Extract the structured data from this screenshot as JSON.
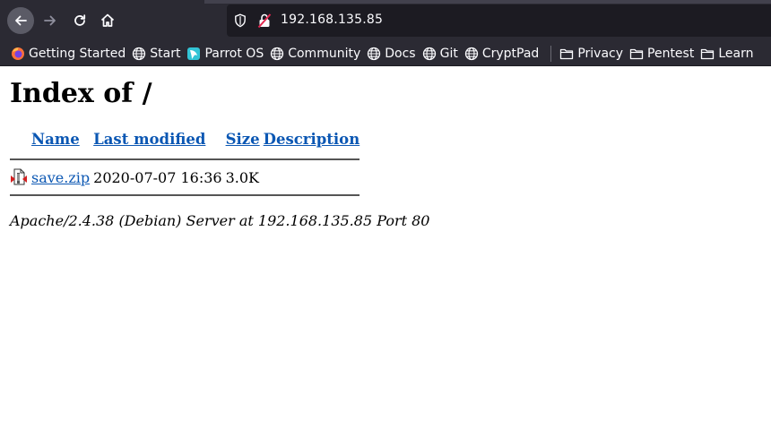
{
  "browser": {
    "url": "192.168.135.85",
    "bookmarks": [
      {
        "label": "Getting Started",
        "icon": "firefox-icon"
      },
      {
        "label": "Start",
        "icon": "globe-icon"
      },
      {
        "label": "Parrot OS",
        "icon": "parrot-icon"
      },
      {
        "label": "Community",
        "icon": "globe-icon"
      },
      {
        "label": "Docs",
        "icon": "globe-icon"
      },
      {
        "label": "Git",
        "icon": "globe-icon"
      },
      {
        "label": "CryptPad",
        "icon": "globe-icon"
      },
      {
        "label": "Privacy",
        "icon": "folder-icon"
      },
      {
        "label": "Pentest",
        "icon": "folder-icon"
      },
      {
        "label": "Learn",
        "icon": "folder-icon"
      }
    ]
  },
  "page": {
    "title": "Index of /",
    "columns": [
      "Name",
      "Last modified",
      "Size",
      "Description"
    ],
    "rows": [
      {
        "name": "save.zip",
        "modified": "2020-07-07 16:36",
        "size": "3.0K",
        "description": ""
      }
    ],
    "footer": "Apache/2.4.38 (Debian) Server at 192.168.135.85 Port 80"
  },
  "colors": {
    "chrome_bg": "#2b2a33",
    "url_bg": "#1c1b22",
    "link": "#0b57b3"
  }
}
